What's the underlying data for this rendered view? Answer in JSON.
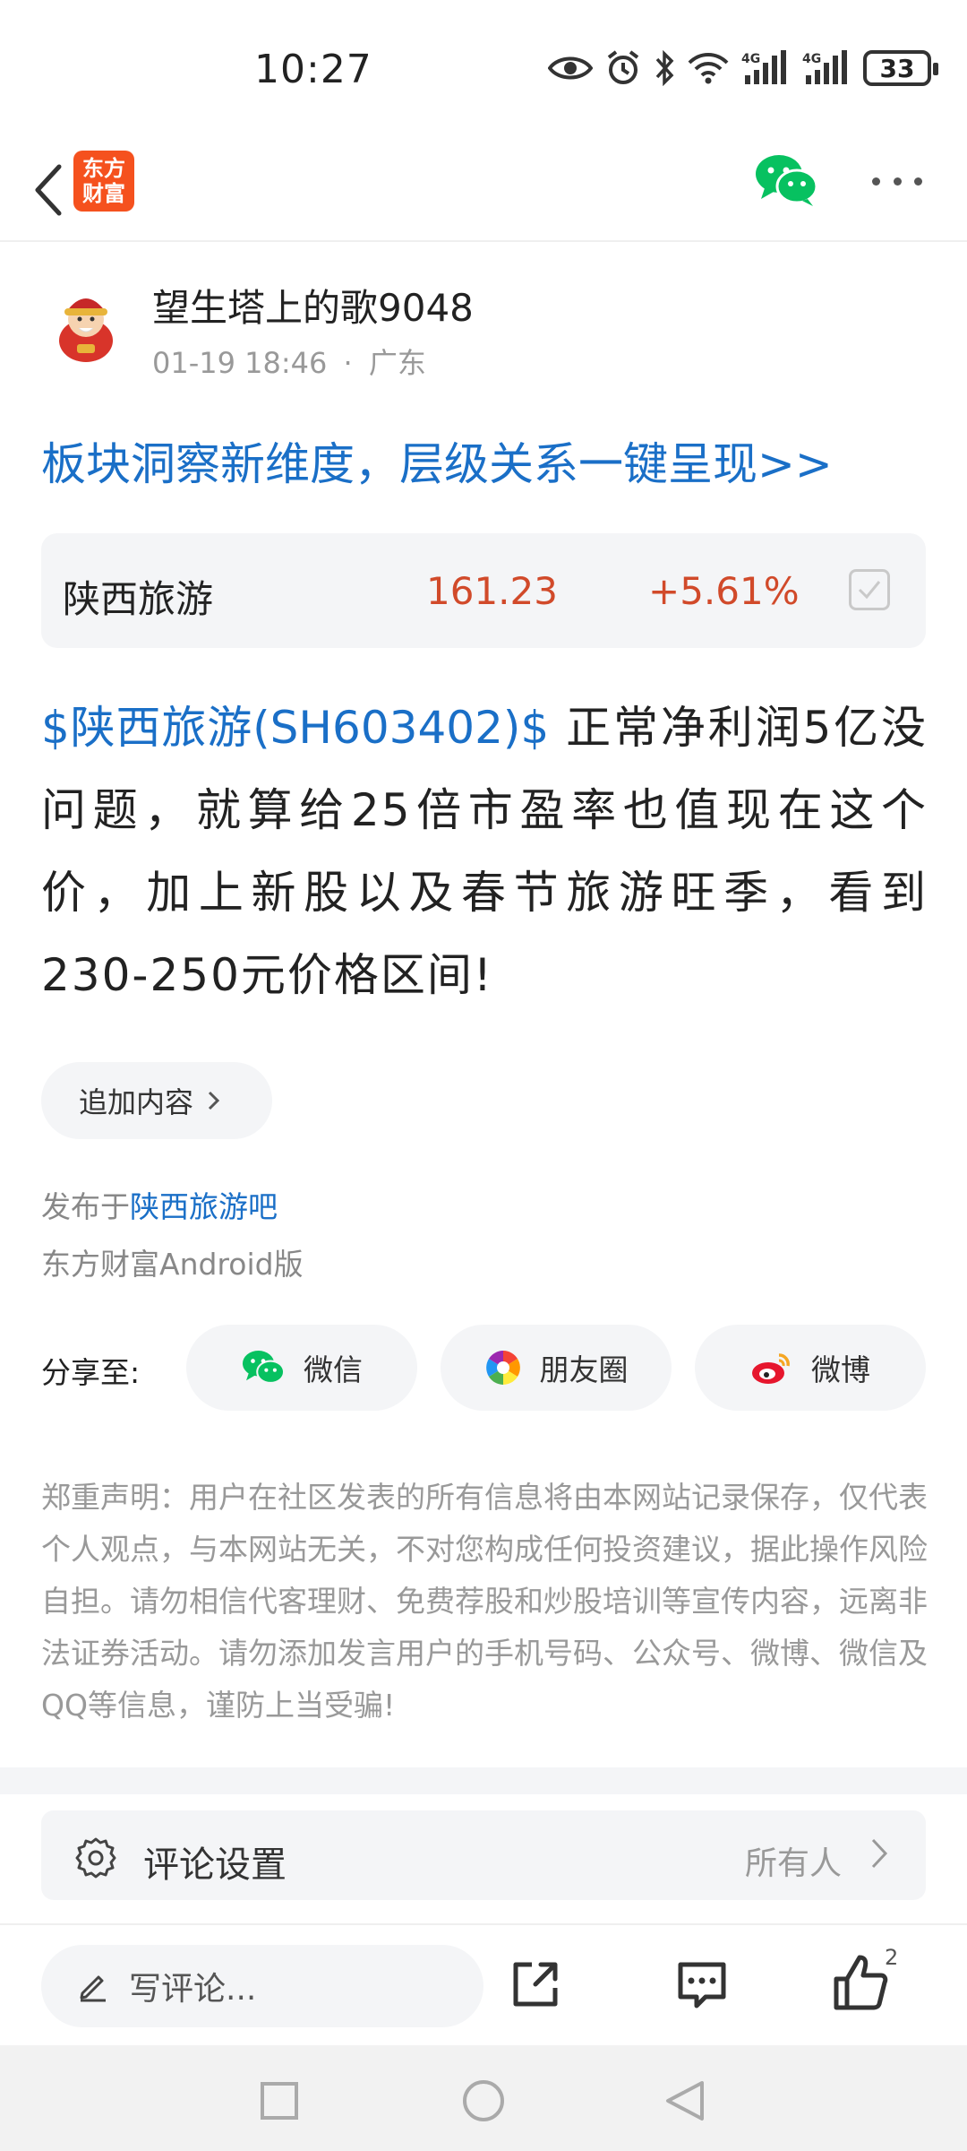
{
  "status_bar": {
    "time": "10:27",
    "battery": "33",
    "icons": [
      "eye-icon",
      "alarm-icon",
      "bluetooth-icon",
      "wifi-icon",
      "signal-4g-icon",
      "signal-4g-icon",
      "battery-icon"
    ]
  },
  "nav": {
    "logo_line1": "东方",
    "logo_line2": "财富",
    "icons": [
      "back-icon",
      "wechat-icon",
      "more-icon"
    ]
  },
  "author": {
    "name": "望生塔上的歌9048",
    "date": "01-19 18:46",
    "separator": "·",
    "location": "广东"
  },
  "promo_link": "板块洞察新维度，层级关系一键呈现>>",
  "stock": {
    "name": "陕西旅游",
    "price": "161.23",
    "change": "+5.61%",
    "price_color": "#d14a2a"
  },
  "post": {
    "tag": "$陕西旅游(SH603402)$",
    "text": "正常净利润5亿没问题，就算给25倍市盈率也值现在这个价，加上新股以及春节旅游旺季，看到230-250元价格区间!"
  },
  "append_button": "追加内容",
  "publish": {
    "prefix": "发布于",
    "bar": "陕西旅游吧",
    "client": "东方财富Android版"
  },
  "share": {
    "label": "分享至:",
    "wechat": "微信",
    "moments": "朋友圈",
    "weibo": "微博"
  },
  "disclaimer": "郑重声明：用户在社区发表的所有信息将由本网站记录保存，仅代表个人观点，与本网站无关，不对您构成任何投资建议，据此操作风险自担。请勿相信代客理财、免费荐股和炒股培训等宣传内容，远离非法证券活动。请勿添加发言用户的手机号码、公众号、微博、微信及QQ等信息，谨防上当受骗!",
  "comment_settings": {
    "label": "评论设置",
    "value": "所有人"
  },
  "action_bar": {
    "comment_placeholder": "写评论...",
    "like_count": "2"
  },
  "colors": {
    "link_blue": "#1a6fc7",
    "up_red": "#d14a2a",
    "brand_orange": "#f5511e",
    "wechat_green": "#07c160"
  }
}
